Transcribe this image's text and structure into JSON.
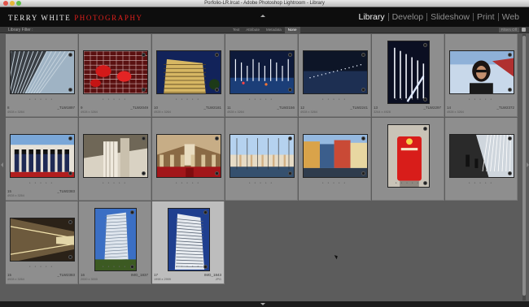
{
  "window": {
    "title": "Porfolio-LR.lrcat - Adobe Photoshop Lightroom - Library"
  },
  "identity": {
    "part1": "TERRY WHITE",
    "part2": " PHOTOGRAPHY"
  },
  "modules": [
    {
      "label": "Library",
      "active": true
    },
    {
      "label": "Develop",
      "active": false
    },
    {
      "label": "Slideshow",
      "active": false
    },
    {
      "label": "Print",
      "active": false
    },
    {
      "label": "Web",
      "active": false
    }
  ],
  "filter": {
    "title": "Library Filter :",
    "tabs": [
      "Text",
      "Attribute",
      "Metadata",
      "None"
    ],
    "active_tab": "None",
    "filters_off": "Filters Off"
  },
  "grid": {
    "rows": [
      [
        {
          "num": "8",
          "file": "_TLW1897",
          "dims": "4928 x 3264",
          "ext": "",
          "thumb": "tower-glass",
          "orient": "land"
        },
        {
          "num": "9",
          "file": "_TLW2049",
          "dims": "4928 x 3264",
          "ext": "",
          "thumb": "lanterns",
          "orient": "land"
        },
        {
          "num": "10",
          "file": "_TLW2181",
          "dims": "4928 x 3264",
          "ext": "",
          "thumb": "night-building",
          "orient": "land"
        },
        {
          "num": "11",
          "file": "_TLW2156",
          "dims": "4928 x 3264",
          "ext": "",
          "thumb": "fountain-lights",
          "orient": "land"
        },
        {
          "num": "12",
          "file": "_TLW2241",
          "dims": "4928 x 3264",
          "ext": "",
          "thumb": "dark-water",
          "orient": "land"
        },
        {
          "num": "13",
          "file": "_TLW2297",
          "dims": "3264 x 4928",
          "ext": "",
          "thumb": "fountain-vertical",
          "orient": "port"
        },
        {
          "num": "14",
          "file": "_TLW2372",
          "dims": "4928 x 3264",
          "ext": "",
          "thumb": "portrait-woman",
          "orient": "land"
        }
      ],
      [
        {
          "num": "15",
          "file": "_TLW2383",
          "dims": "4928 x 3264",
          "ext": "",
          "thumb": "guards",
          "orient": "land"
        },
        {
          "num": "",
          "file": "",
          "dims": "",
          "ext": "",
          "thumb": "columns",
          "orient": "land"
        },
        {
          "num": "",
          "file": "",
          "dims": "",
          "ext": "",
          "thumb": "church",
          "orient": "land"
        },
        {
          "num": "",
          "file": "",
          "dims": "",
          "ext": "",
          "thumb": "harbor",
          "orient": "land"
        },
        {
          "num": "",
          "file": "",
          "dims": "",
          "ext": "",
          "thumb": "houses",
          "orient": "land"
        },
        {
          "num": "",
          "file": "",
          "dims": "",
          "ext": "",
          "thumb": "postbox",
          "orient": "port"
        },
        {
          "num": "",
          "file": "",
          "dims": "",
          "ext": "",
          "thumb": "fountain-kids",
          "orient": "land"
        }
      ],
      [
        {
          "num": "15",
          "file": "_TLW2383",
          "dims": "4928 x 3264",
          "ext": "",
          "thumb": "tunnel",
          "orient": "land"
        },
        {
          "num": "16",
          "file": "IMG_1837",
          "dims": "2000 x 3000",
          "ext": "",
          "thumb": "twisted-tower",
          "orient": "port"
        },
        {
          "num": "17",
          "file": "IMG_1843",
          "dims": "1998 x 2999",
          "ext": "JPG",
          "thumb": "turning-torso",
          "orient": "port",
          "selected": true
        }
      ]
    ]
  },
  "colors": {
    "accent_red": "#e0201c",
    "grid_bg": "#5c5c5c",
    "cell_bg": "#8e8e8e",
    "cell_selected": "#bdbdbd"
  }
}
